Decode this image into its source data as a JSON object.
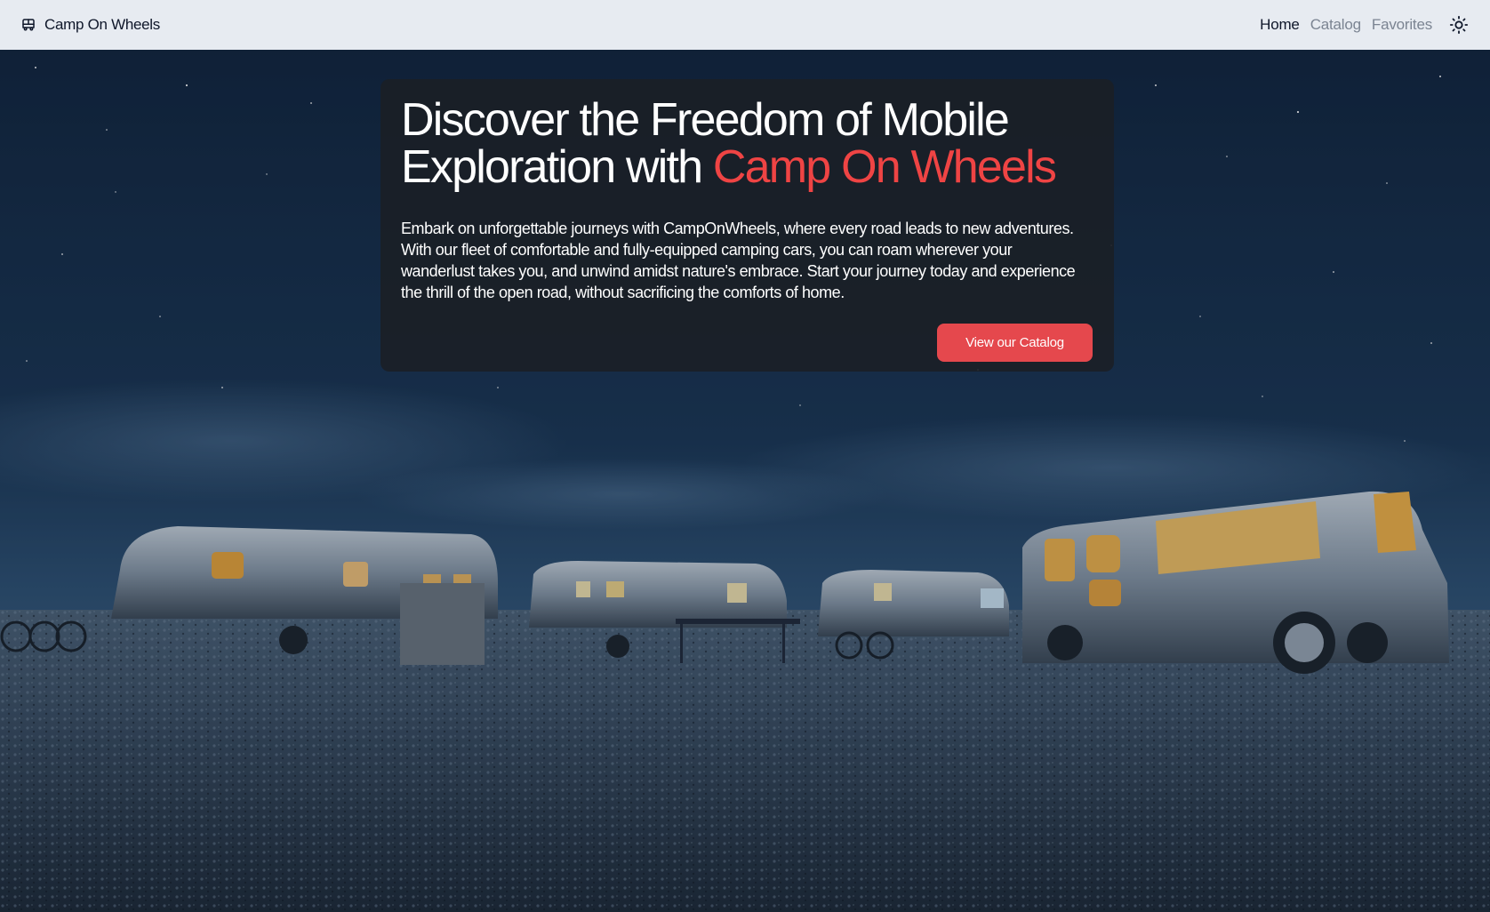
{
  "navbar": {
    "brand_icon": "camper-van-icon",
    "brand_name": "Camp On Wheels",
    "links": [
      {
        "label": "Home",
        "active": true
      },
      {
        "label": "Catalog",
        "active": false
      },
      {
        "label": "Favorites",
        "active": false
      }
    ],
    "theme_icon": "sun-icon"
  },
  "hero": {
    "title_part1": "Discover the Freedom of Mobile Exploration with ",
    "title_accent": "Camp On Wheels",
    "description": "Embark on unforgettable journeys with CampOnWheels, where every road leads to new adventures. With our fleet of comfortable and fully-equipped camping cars, you can roam wherever your wanderlust takes you, and unwind amidst nature's embrace. Start your journey today and experience the thrill of the open road, without sacrificing the comforts of home.",
    "cta_label": "View our Catalog",
    "background_image": "night-sky-campsite-with-airstream-trailers"
  },
  "colors": {
    "accent": "#ef4444",
    "button": "#e5484d",
    "navbar_bg": "#e7ebf1",
    "card_bg": "#1b1f26"
  }
}
